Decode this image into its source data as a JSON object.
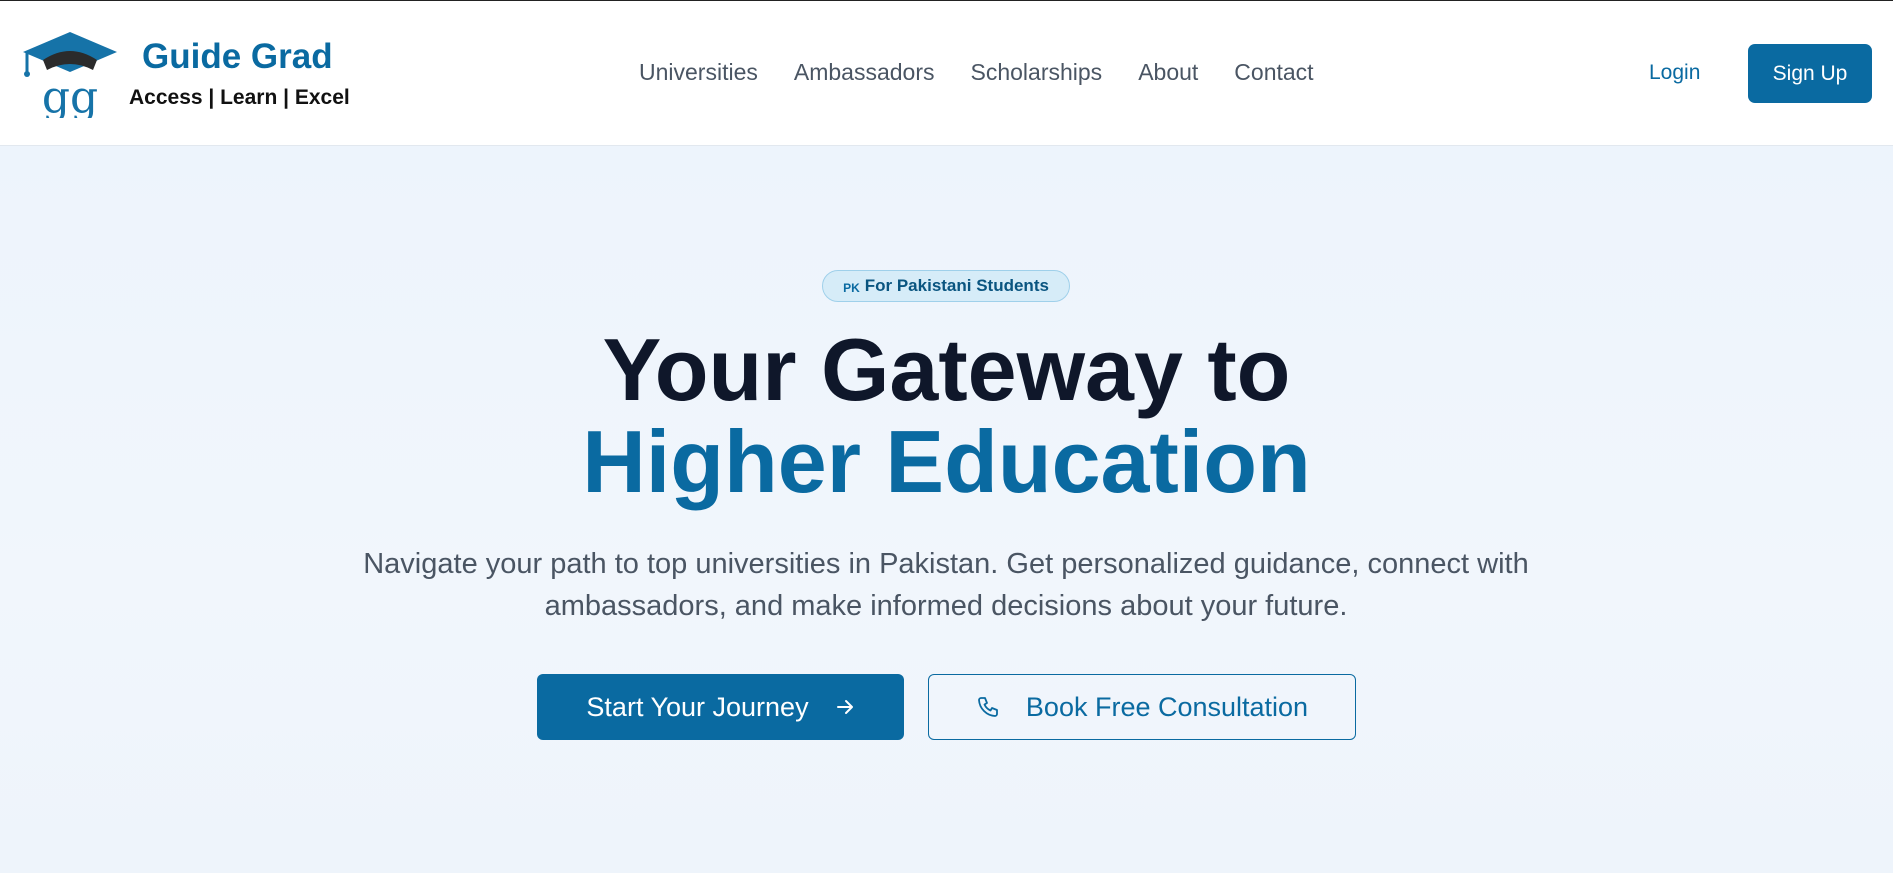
{
  "brand": {
    "logo_letters": "gg",
    "name": "Guide Grad",
    "tagline": "Access | Learn | Excel",
    "color": "#0a6aa1"
  },
  "nav": {
    "links": [
      "Universities",
      "Ambassadors",
      "Scholarships",
      "About",
      "Contact"
    ],
    "login_label": "Login",
    "signup_label": "Sign Up"
  },
  "hero": {
    "badge_flag": "PK",
    "badge_text": "For Pakistani Students",
    "headline_line1": "Your Gateway to",
    "headline_line2": "Higher Education",
    "subtitle": "Navigate your path to top universities in Pakistan. Get personalized guidance, connect with ambassadors, and make informed decisions about your future.",
    "primary_cta": "Start Your Journey",
    "primary_cta_icon": "arrow-right-icon",
    "secondary_cta": "Book Free Consultation",
    "secondary_cta_icon": "phone-icon"
  },
  "colors": {
    "primary": "#0a6aa1",
    "heading": "#0f172a",
    "body_text": "#4a5563",
    "hero_bg": "#eef5fc"
  }
}
